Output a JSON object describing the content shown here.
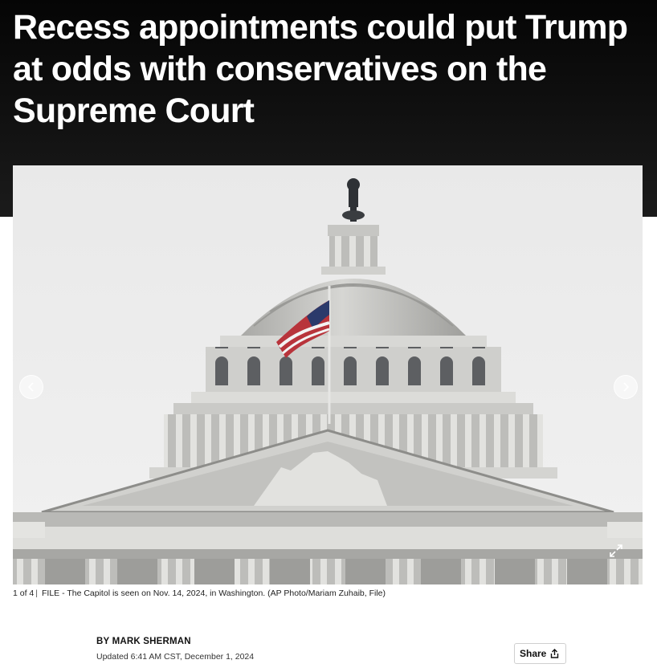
{
  "article": {
    "headline": "Recess appointments could put Trump at odds with conservatives on the Supreme Court",
    "byline_prefix": "BY",
    "author": "MARK SHERMAN",
    "updated": "Updated 6:41 AM CST, December 1, 2024"
  },
  "gallery": {
    "counter": "1 of 4",
    "separator": "|",
    "caption": "FILE - The Capitol is seen on Nov. 14, 2024, in Washington. (AP Photo/Mariam Zuhaib, File)",
    "prev_icon": "chevron-left-icon",
    "next_icon": "chevron-right-icon",
    "expand_icon": "expand-icon"
  },
  "share": {
    "label": "Share",
    "icon": "share-icon"
  },
  "colors": {
    "header_bg": "#0b0b0b",
    "headline_text": "#ffffff",
    "sky": "#ebebeb",
    "stone": "#c9c9c6"
  }
}
